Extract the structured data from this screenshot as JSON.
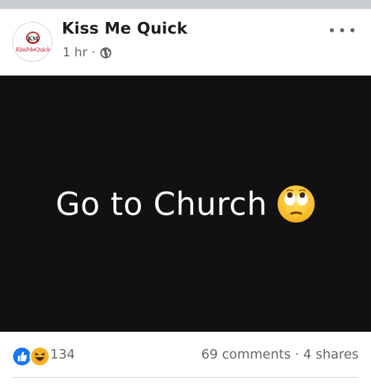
{
  "post": {
    "page_name": "Kiss Me Quick",
    "avatar_text": "KissMeQuick",
    "avatar_monogram": "KMQ",
    "time": "1 hr",
    "meta_separator": "·",
    "privacy_icon": "globe-icon",
    "more_icon": "more-horizontal-icon",
    "content_text": "Go to Church",
    "content_emoji": "face-with-rolling-eyes-icon",
    "background_color": "#111111"
  },
  "reactions": {
    "icons": [
      "like-reaction-icon",
      "haha-reaction-icon"
    ],
    "count": "134",
    "comments": "69 comments",
    "separator": "·",
    "shares": "4 shares"
  },
  "colors": {
    "brand_red": "#c0272d",
    "like_blue": "#1877f2",
    "haha_yellow": "#f7b125",
    "secondary_text": "#65676b"
  }
}
